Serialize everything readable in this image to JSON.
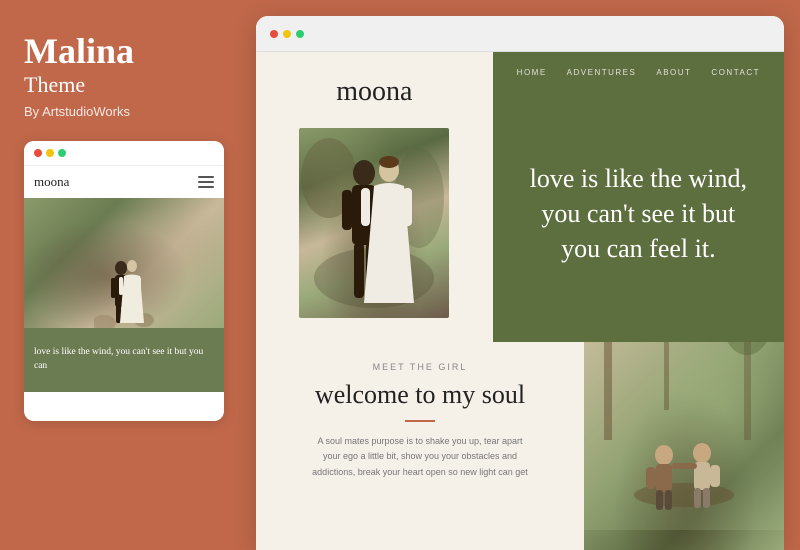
{
  "left": {
    "title": "Malina",
    "subtitle": "Theme",
    "author": "By ArtstudioWorks"
  },
  "mobile_preview": {
    "logo": "moona",
    "quote": "love is like the wind, you can't see it but you can"
  },
  "browser": {
    "dots": [
      "red",
      "yellow",
      "green"
    ]
  },
  "website": {
    "logo": "moona",
    "nav": [
      "HOME",
      "ADVENTURES",
      "ABOUT",
      "CONTACT"
    ],
    "hero_quote": "love is like the wind, you can't see it but you can feel it.",
    "meet_label": "MEET THE GIRL",
    "welcome_title": "welcome to my soul",
    "welcome_text": "A soul mates purpose is to shake you up, tear apart your ego a little bit, show you your obstacles and addictions, break your heart open so new light can get"
  }
}
